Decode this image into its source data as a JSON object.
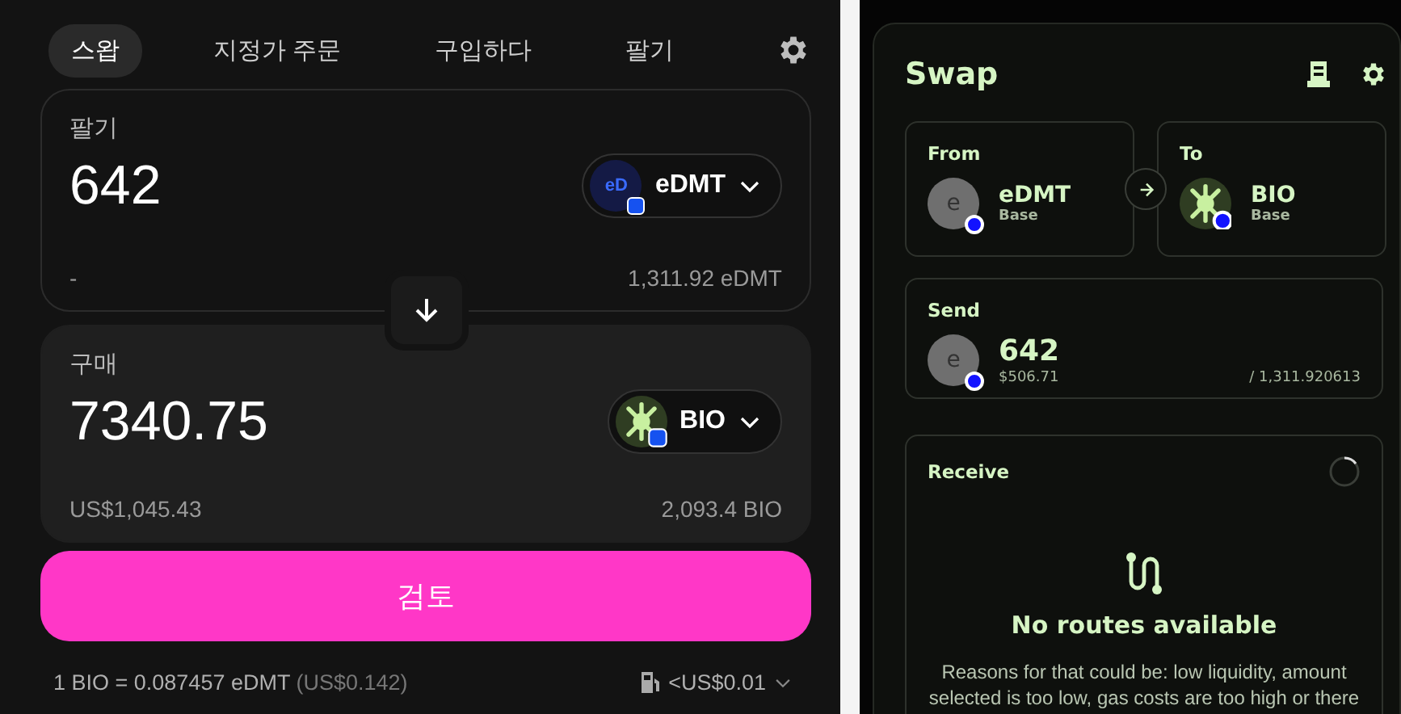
{
  "swap_widget": {
    "tabs": [
      {
        "label": "스왑",
        "selected": true
      },
      {
        "label": "지정가 주문",
        "selected": false
      },
      {
        "label": "구입하다",
        "selected": false
      },
      {
        "label": "팔기",
        "selected": false
      }
    ],
    "sell": {
      "label": "팔기",
      "amount": "642",
      "fiat": "-",
      "token": {
        "symbol": "eDMT",
        "kind": "letters",
        "icon_text": "eD"
      },
      "balance": "1,311.92 eDMT"
    },
    "buy": {
      "label": "구매",
      "amount": "7340.75",
      "fiat": "US$1,045.43",
      "token": {
        "symbol": "BIO",
        "kind": "bio"
      },
      "balance": "2,093.4 BIO"
    },
    "review_button": "검토",
    "rate": "1 BIO = 0.087457 eDMT",
    "rate_fiat": "(US$0.142)",
    "gas_fee": "<US$0.01"
  },
  "bridge_widget": {
    "title": "Swap",
    "from": {
      "label": "From",
      "symbol": "eDMT",
      "chain": "Base",
      "kind": "letter",
      "icon_text": "e"
    },
    "to": {
      "label": "To",
      "symbol": "BIO",
      "chain": "Base",
      "kind": "bio"
    },
    "send": {
      "label": "Send",
      "amount": "642",
      "fiat": "$506.71",
      "balance": "/ 1,311.920613",
      "kind": "letter",
      "icon_text": "e"
    },
    "receive": {
      "label": "Receive",
      "empty_title": "No routes available",
      "empty_text": "Reasons for that could be: low liquidity, amount selected is too low, gas costs are too high or there"
    }
  }
}
